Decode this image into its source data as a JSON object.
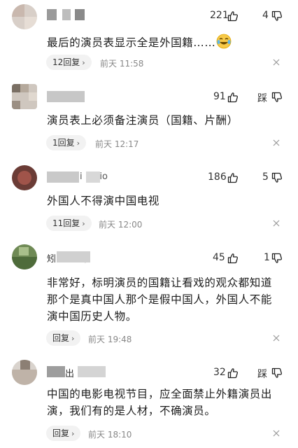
{
  "comments": [
    {
      "likes": "221",
      "right_count": "4",
      "text_lines": [
        "最后的演员表显示全是外国籍……"
      ],
      "emoji": "laughing-tears-emoji",
      "reply_label": "12回复",
      "time": "前天 11:58"
    },
    {
      "likes": "91",
      "right_label": "踩",
      "text_lines": [
        "演员表上必须备注演员（国籍、片酬）"
      ],
      "reply_label": "1回复",
      "time": "前天 12:17"
    },
    {
      "name_fragment": "i      io",
      "likes": "186",
      "right_count": "5",
      "text_lines": [
        "外国人不得演中国电视"
      ],
      "reply_label": "11回复",
      "time": "前天 12:00"
    },
    {
      "name_fragment": "矧        臻",
      "likes": "45",
      "right_count": "1",
      "text_lines": [
        "非常好，标明演员的国籍让看戏的观众都知道",
        "那个是真中国人那个是假中国人，外国人不能",
        "演中国历史人物。"
      ],
      "reply_label": "回复",
      "time": "前天 19:48"
    },
    {
      "name_fragment": "出",
      "likes": "32",
      "right_label": "踩",
      "text_lines": [
        "中国的电影电视节目，应全面禁止外籍演员出",
        "演，我们有的是人材，不确演员。"
      ],
      "reply_label": "回复",
      "time": "前天 18:10"
    }
  ],
  "colors": {
    "background": "#ffffff",
    "chip": "#f2f2f2",
    "time": "#888888"
  }
}
